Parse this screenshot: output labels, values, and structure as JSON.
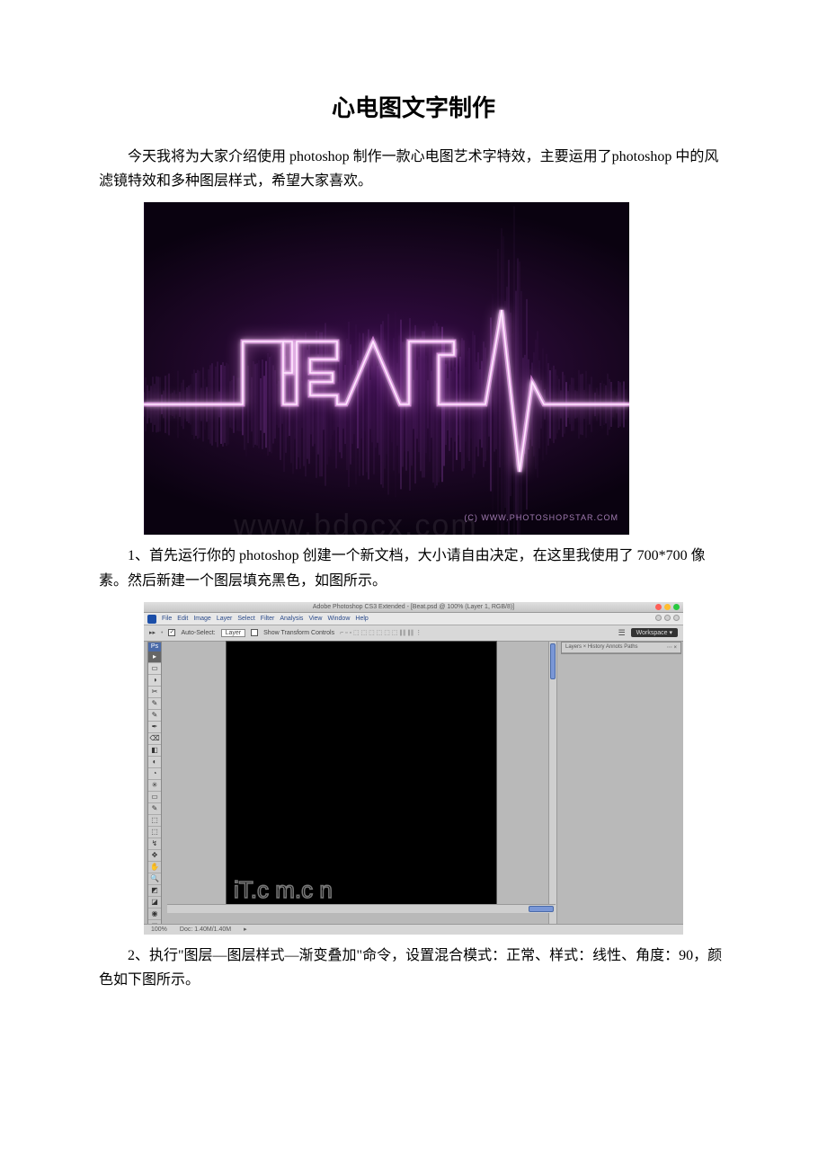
{
  "title": "心电图文字制作",
  "intro": "今天我将为大家介绍使用 photoshop 制作一款心电图艺术字特效，主要运用了photoshop 中的风滤镜特效和多种图层样式，希望大家喜欢。",
  "step1": "1、首先运行你的 photoshop 创建一个新文档，大小请自由决定，在这里我使用了 700*700 像素。然后新建一个图层填充黑色，如图所示。",
  "step2": "2、执行\"图层—图层样式—渐变叠加\"命令，设置混合模式：正常、样式：线性、角度：90，颜色如下图所示。",
  "beat": {
    "copyright": "(C) WWW.PHOTOSHOPSTAR.COM",
    "watermark": "www.bdocx.com"
  },
  "ps": {
    "title": "Adobe Photoshop CS3 Extended - [Beat.psd @ 100% (Layer 1, RGB/8)]",
    "menus": [
      "File",
      "Edit",
      "Image",
      "Layer",
      "Select",
      "Filter",
      "Analysis",
      "View",
      "Window",
      "Help"
    ],
    "options": {
      "tool": "▸▸",
      "autoSelectLabel": "Auto-Select:",
      "autoSelectValue": "Layer",
      "showTransformLabel": "Show Transform Controls",
      "glyphs": "⌐ ▫ ▫   ⬚ ⬚ ⬚   ⬚ ⬚ ⬚  ∥∥ ∥∥  ⋮",
      "workspace": "Workspace ▾"
    },
    "panelTabs": "Layers × History  Annots  Paths",
    "panelClose": "⋯ ×",
    "status": {
      "zoom": "100%",
      "doc": "Doc: 1.40M/1.40M"
    },
    "toolsHeader": "Ps",
    "tools": [
      "▸",
      "▭",
      "◑",
      "✂",
      "✎",
      "✎",
      "✒",
      "⌫",
      "◧",
      "◐",
      "◔",
      "✳",
      "▭",
      "✎",
      "⬚",
      "⬚",
      "↯",
      "✥",
      "✋",
      "🔍",
      "◩",
      "◪",
      "◉",
      "□"
    ],
    "canvasLogo": "iT.c m.c n"
  }
}
